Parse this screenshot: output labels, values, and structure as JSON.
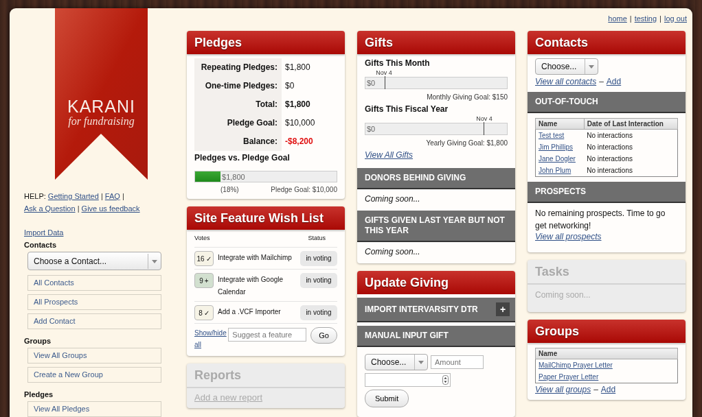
{
  "top_links": {
    "items": [
      "home",
      "testing",
      "log out"
    ],
    "separator": "|"
  },
  "logo": {
    "name": "KARANI",
    "tagline": "for fundraising"
  },
  "help": {
    "label": "HELP:",
    "links": [
      "Getting Started",
      "FAQ",
      "Ask a Question",
      "Give us feedback"
    ],
    "separator": "|"
  },
  "sidebar": {
    "import_link": "Import Data",
    "sections": [
      {
        "heading": "Contacts",
        "select": "Choose a Contact...",
        "items": [
          "All Contacts",
          "All Prospects",
          "Add Contact"
        ]
      },
      {
        "heading": "Groups",
        "items": [
          "View All Groups",
          "Create a New Group"
        ]
      },
      {
        "heading": "Pledges",
        "items": [
          "View All Pledges"
        ]
      }
    ]
  },
  "pledges": {
    "title": "Pledges",
    "disabled": false,
    "rows": [
      {
        "label": "Repeating Pledges:",
        "value": "$1,800",
        "kind": "plain"
      },
      {
        "label": "One-time Pledges:",
        "value": "$0",
        "kind": "plain"
      },
      {
        "label": "Total:",
        "value": "$1,800",
        "kind": "bold"
      },
      {
        "label": "Pledge Goal:",
        "value": "$10,000",
        "kind": "plain"
      },
      {
        "label": "Balance:",
        "value": "-$8,200",
        "kind": "negative"
      }
    ],
    "chart_title": "Pledges vs. Pledge Goal",
    "progress": {
      "level": 0.18,
      "amount": "$1,800",
      "percent": "(18%)",
      "goal": "Pledge Goal: $10,000"
    }
  },
  "wish_list": {
    "title": "Site Feature Wish List",
    "disabled": false,
    "columns": [
      "Votes",
      "Status"
    ],
    "items": [
      {
        "votes": "16",
        "mark": "✓",
        "voted": true,
        "feature": "Integrate with Mailchimp",
        "status": "in voting"
      },
      {
        "votes": "9",
        "mark": "+",
        "voted": false,
        "feature": "Integrate with Google Calendar",
        "status": "in voting"
      },
      {
        "votes": "8",
        "mark": "✓",
        "voted": true,
        "feature": "Add a .VCF Importer",
        "status": "in voting"
      }
    ],
    "toggle_link": "Show/hide all",
    "placeholder": "Suggest a feature",
    "button": "Go"
  },
  "reports": {
    "title": "Reports",
    "disabled": true,
    "link": "Add a new report"
  },
  "gifts": {
    "title": "Gifts",
    "disabled": false,
    "meters": [
      {
        "heading": "Gifts This Month",
        "marker": {
          "label": "Nov 4",
          "level": 0.135
        },
        "amount": "$0",
        "goal": "Monthly Giving Goal: $150"
      },
      {
        "heading": "Gifts This Fiscal Year",
        "marker": {
          "label": "Nov 4",
          "level": 0.837
        },
        "amount": "$0",
        "goal": "Yearly Giving Goal: $1,800"
      }
    ],
    "link": "View All Gifts",
    "sections": [
      {
        "heading": "DONORS BEHIND GIVING",
        "text": "Coming soon..."
      },
      {
        "heading": "GIFTS GIVEN LAST YEAR BUT NOT THIS YEAR",
        "text": "Coming soon..."
      }
    ]
  },
  "update_giving": {
    "title": "Update Giving",
    "disabled": false,
    "sections": [
      {
        "heading": "IMPORT INTERVARSITY DTR",
        "expand_button": "+"
      },
      {
        "heading": "MANUAL INPUT GIFT"
      }
    ],
    "form": {
      "select": "Choose...",
      "amount_placeholder": "Amount",
      "submit": "Submit"
    }
  },
  "contacts": {
    "title": "Contacts",
    "disabled": false,
    "select": "Choose...",
    "links": [
      "View all contacts",
      "Add"
    ],
    "separator": "–",
    "out_of_touch": {
      "heading": "OUT-OF-TOUCH",
      "columns": [
        "Name",
        "Date of Last Interaction"
      ],
      "rows": [
        {
          "name": "Test test",
          "last": "No interactions"
        },
        {
          "name": "Jim Phillips",
          "last": "No interactions"
        },
        {
          "name": "Jane Dogler",
          "last": "No interactions"
        },
        {
          "name": "John Plum",
          "last": "No interactions"
        }
      ]
    },
    "prospects": {
      "heading": "PROSPECTS",
      "text": "No remaining prospects. Time to go get networking!",
      "link": "View all prospects"
    }
  },
  "tasks": {
    "title": "Tasks",
    "disabled": true,
    "text": "Coming soon..."
  },
  "groups": {
    "title": "Groups",
    "disabled": false,
    "columns": [
      "Name"
    ],
    "rows": [
      "MailChimp Prayer Letter",
      "Paper Prayer Letter"
    ],
    "links": [
      "View all groups",
      "Add"
    ],
    "separator": "–"
  }
}
